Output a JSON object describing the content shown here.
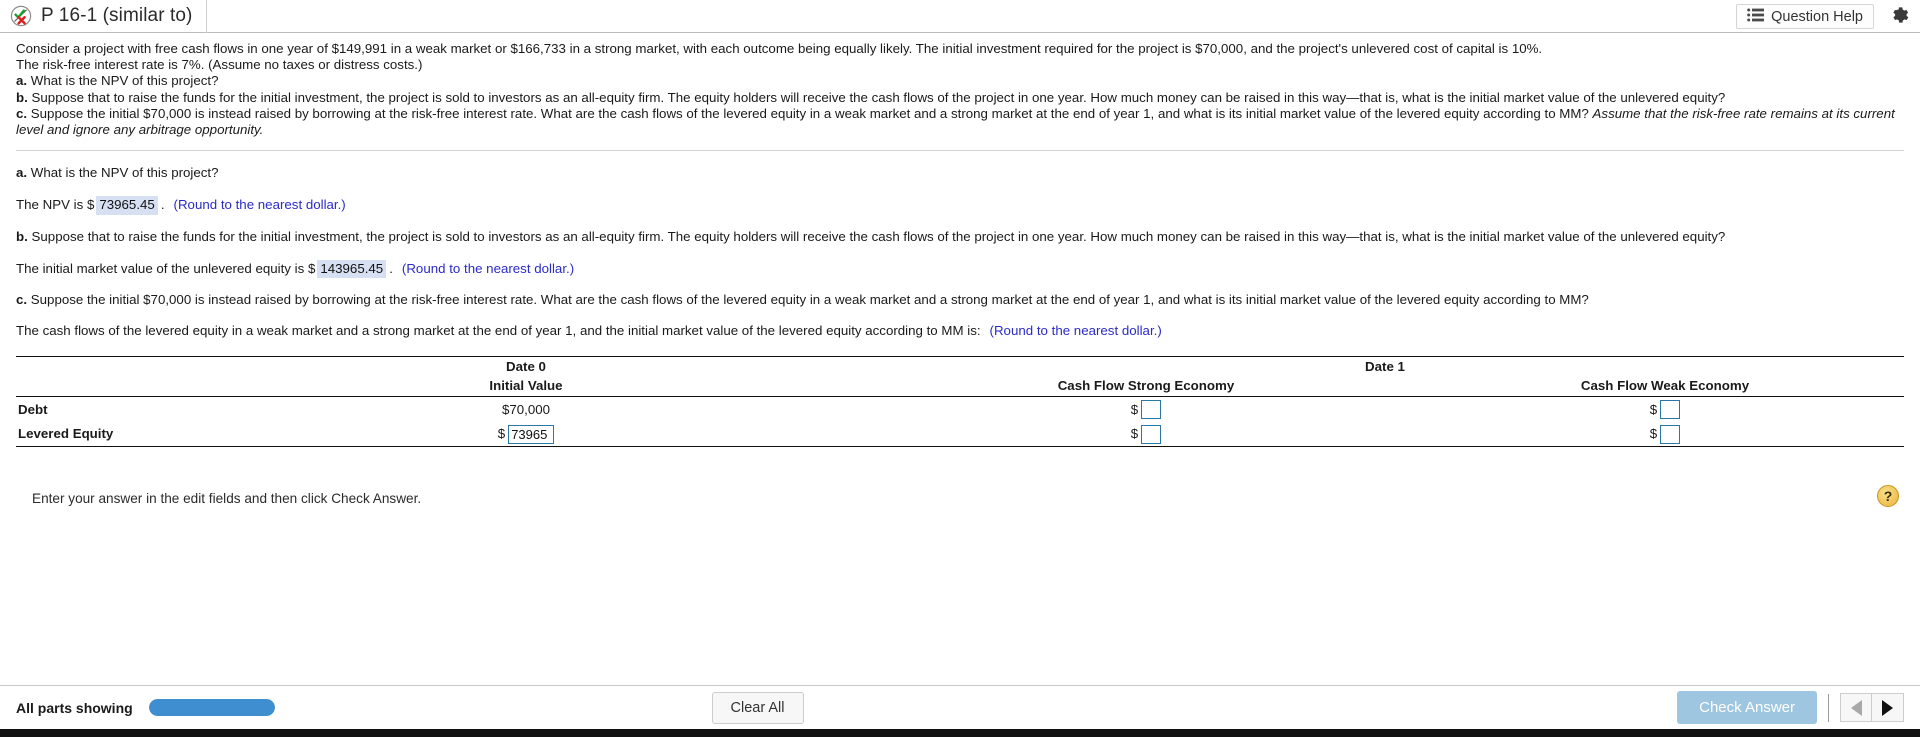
{
  "header": {
    "status_icon": "check-x-circle-icon",
    "title": "P 16-1 (similar to)",
    "question_help_label": "Question Help",
    "question_help_icon": "list-lines-icon",
    "gear_icon": "gear-icon"
  },
  "prompt": {
    "line1": "Consider a project with free cash flows in one year of $149,991 in a weak market or $166,733 in a strong market, with each outcome being equally likely. The initial investment required for the project is $70,000, and the project's unlevered cost of capital is 10%.",
    "line2": "The risk-free interest rate is 7%. (Assume no taxes or distress costs.)",
    "a_label": "a.",
    "a_text": "What is the NPV of this project?",
    "b_label": "b.",
    "b_text": "Suppose that to raise the funds for the initial investment, the project is sold to investors as an all-equity firm. The equity holders will receive the cash flows of the project in one year. How much money can be raised in this way—that is, what is the initial market value of the unlevered equity?",
    "c_label": "c.",
    "c_text": "Suppose the initial $70,000 is instead raised by borrowing at the risk-free interest rate. What are the cash flows of the levered equity in a weak market and a strong market at the end of year 1, and what is its initial market value of the levered equity according to MM?",
    "c_italic": "Assume that the risk-free rate remains at its current level and ignore any arbitrage opportunity."
  },
  "parts": {
    "a": {
      "label": "a.",
      "question": "What is the NPV of this project?",
      "answer_prefix": "The NPV is $",
      "answer_value": "73965.45",
      "answer_suffix": ".",
      "round_note": "(Round to the nearest dollar.)"
    },
    "b": {
      "label": "b.",
      "question": "Suppose that to raise the funds for the initial investment, the project is sold to investors as an all-equity firm. The equity holders will receive the cash flows of the project in one year. How much money can be raised in this way—that is, what is the initial market value of the unlevered equity?",
      "answer_prefix": "The initial market value of the unlevered equity is $",
      "answer_value": "143965.45",
      "answer_suffix": ".",
      "round_note": "(Round to the nearest dollar.)"
    },
    "c": {
      "label": "c.",
      "question": "Suppose the initial $70,000 is instead raised by borrowing at the risk-free interest rate. What are the cash flows of the levered equity in a weak market and a strong market at the end of year 1, and what is its initial market value of the levered equity according to MM?",
      "answer_prefix": "The cash flows of the levered equity in a weak market and a strong market at the end of year 1, and the initial market value of the levered equity according to MM is:",
      "round_note": "(Round to the nearest dollar.)"
    }
  },
  "table": {
    "group_headers": {
      "date0": "Date 0",
      "date1": "Date 1"
    },
    "columns": [
      "",
      "Initial Value",
      "Cash Flow Strong Economy",
      "Cash Flow Weak Economy"
    ],
    "rows": [
      {
        "label": "Debt",
        "initial_value": "$70,000",
        "initial_is_input": false,
        "strong": "",
        "weak": "",
        "dollar": "$"
      },
      {
        "label": "Levered Equity",
        "initial_value": "73965",
        "initial_is_input": true,
        "strong": "",
        "weak": "",
        "dollar": "$"
      }
    ]
  },
  "footer": {
    "instruction": "Enter your answer in the edit fields and then click Check Answer.",
    "help_glyph": "?",
    "parts_label": "All parts showing",
    "progress_percent": 100,
    "clear_all_label": "Clear All",
    "check_answer_label": "Check Answer",
    "prev_icon": "triangle-left-icon",
    "next_icon": "triangle-right-icon"
  },
  "colors": {
    "accent_blue": "#3f8ed0",
    "check_button": "#9ec6e0",
    "link_blue": "#2b2bc8",
    "input_border": "#2a78a8",
    "highlight": "#d7e0f2"
  }
}
